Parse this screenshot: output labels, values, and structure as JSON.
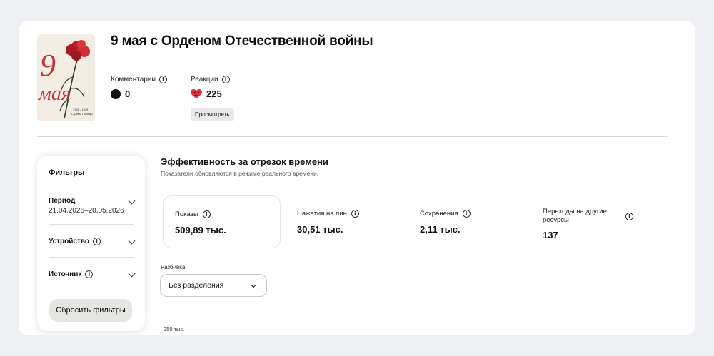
{
  "pin": {
    "title": "9 мая с Орденом Отечественной войны",
    "cover": {
      "big_text": "9 мая",
      "years": "1941 - 1945",
      "caption": "С Днем Победы",
      "accent_color": "#b5262c"
    }
  },
  "stats": {
    "comments": {
      "label": "Комментарии",
      "value": "0",
      "icon": "comment-bubble-icon"
    },
    "reactions": {
      "label": "Реакции",
      "value": "225",
      "icon": "heart-eyes-icon",
      "button": "Просмотреть"
    }
  },
  "filters": {
    "title": "Фильтры",
    "period": {
      "label": "Период",
      "value": "21.04.2026–20.05.2026"
    },
    "device": {
      "label": "Устройство"
    },
    "source": {
      "label": "Источник"
    },
    "reset": "Сбросить фильтры"
  },
  "performance": {
    "title": "Эффективность за отрезок времени",
    "subtitle": "Показатели обновляются в режиме реального времени.",
    "metrics": [
      {
        "label": "Показы",
        "value": "509,89 тыс.",
        "active": true
      },
      {
        "label": "Нажатия на пин",
        "value": "30,51 тыс."
      },
      {
        "label": "Сохранения",
        "value": "2,11 тыс."
      },
      {
        "label": "Переходы на другие ресурсы",
        "value": "137"
      }
    ],
    "breakdown_label": "Разбивка:",
    "breakdown_value": "Без разделения",
    "y_tick": "250 тыс."
  },
  "colors": {
    "background": "#eef0f3",
    "card": "#ffffff",
    "reaction_red": "#e0343d"
  }
}
